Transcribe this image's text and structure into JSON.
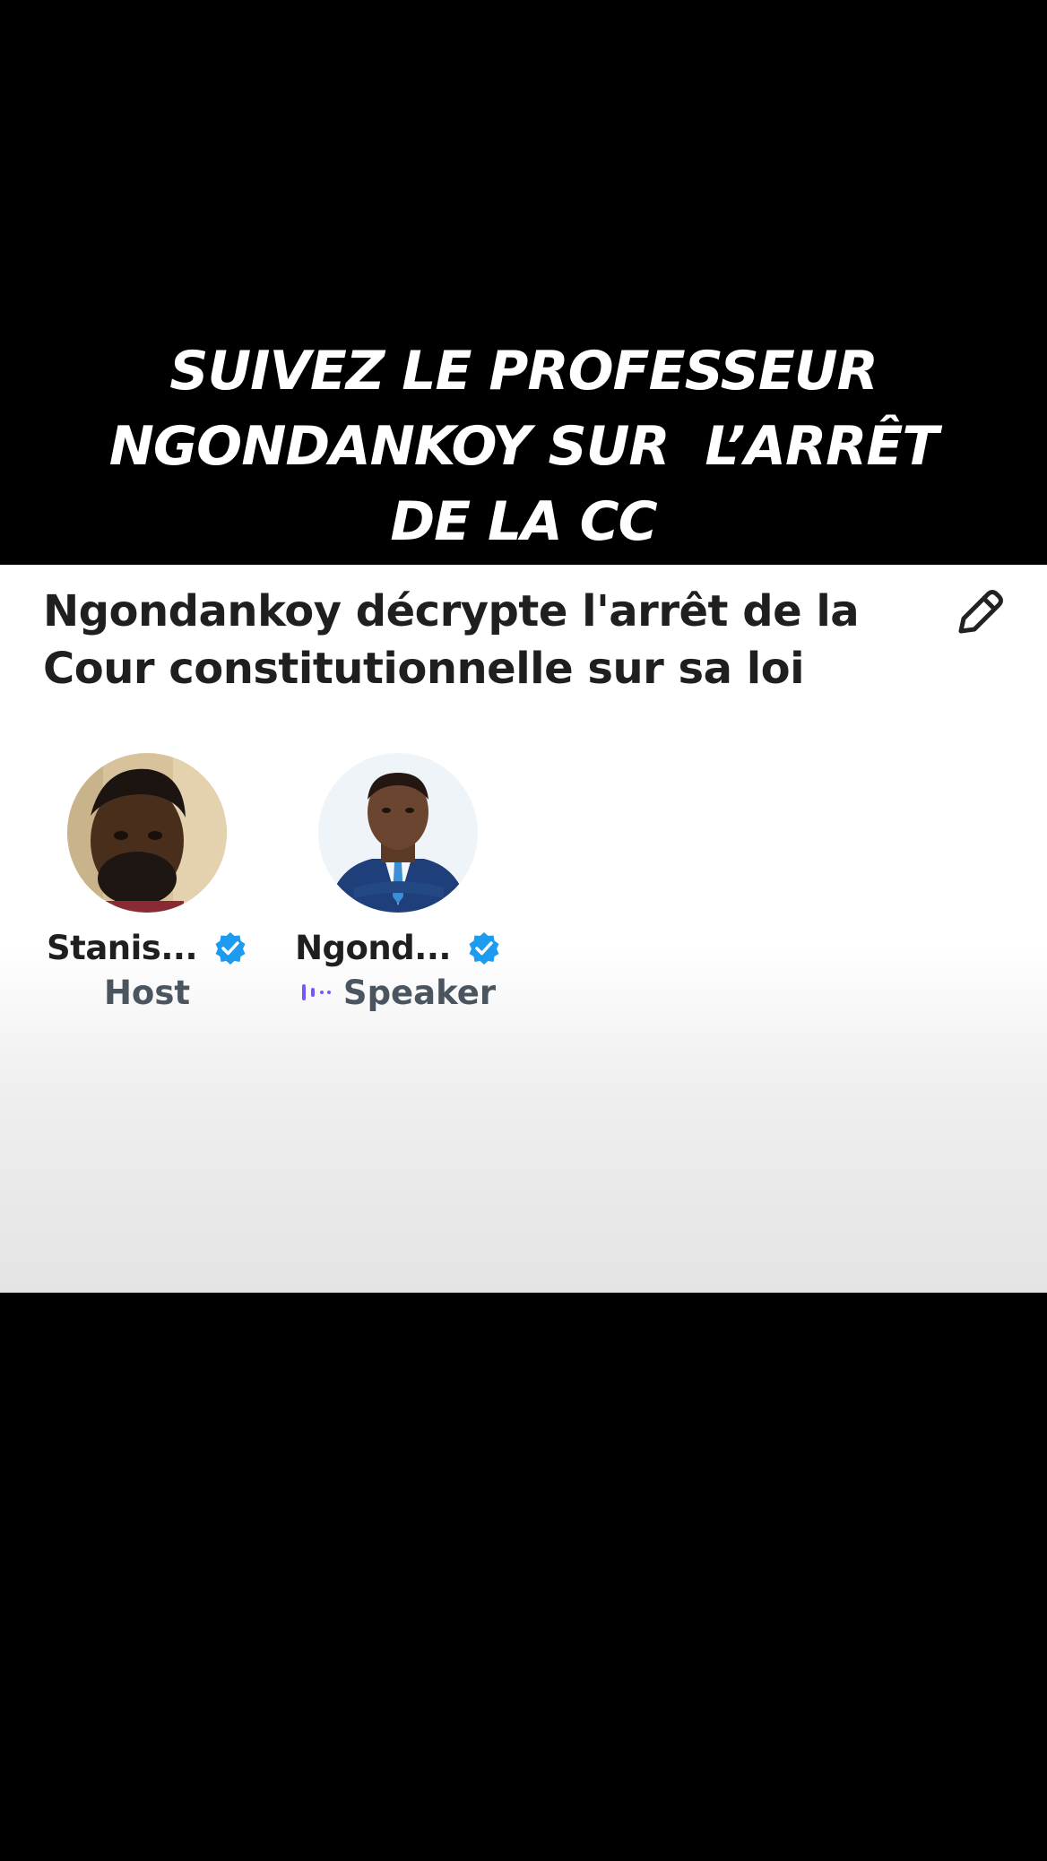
{
  "overlay": {
    "line1": "SUIVEZ LE PROFESSEUR",
    "line2": "NGONDANKOY SUR  L’ARRÊT",
    "line3": "DE LA CC"
  },
  "space": {
    "title_line1": "Ngondankoy décrypte l'arrêt de la",
    "title_line2": "Cour constitutionnelle sur sa loi",
    "edit_icon": "pencil-icon"
  },
  "participants": [
    {
      "name": "Stanis...",
      "role": "Host",
      "verified": true,
      "verified_icon": "verified-badge-icon",
      "avatar_icon": "avatar-photo"
    },
    {
      "name": "Ngond...",
      "role": "Speaker",
      "verified": true,
      "verified_icon": "verified-badge-icon",
      "speaking_icon": "audio-waveform-icon",
      "avatar_icon": "avatar-photo"
    }
  ],
  "colors": {
    "verified_blue": "#1d9bf0",
    "speaking_purple": "#7856ff",
    "title_text": "#1f1f1f",
    "role_text": "#4a5560"
  }
}
